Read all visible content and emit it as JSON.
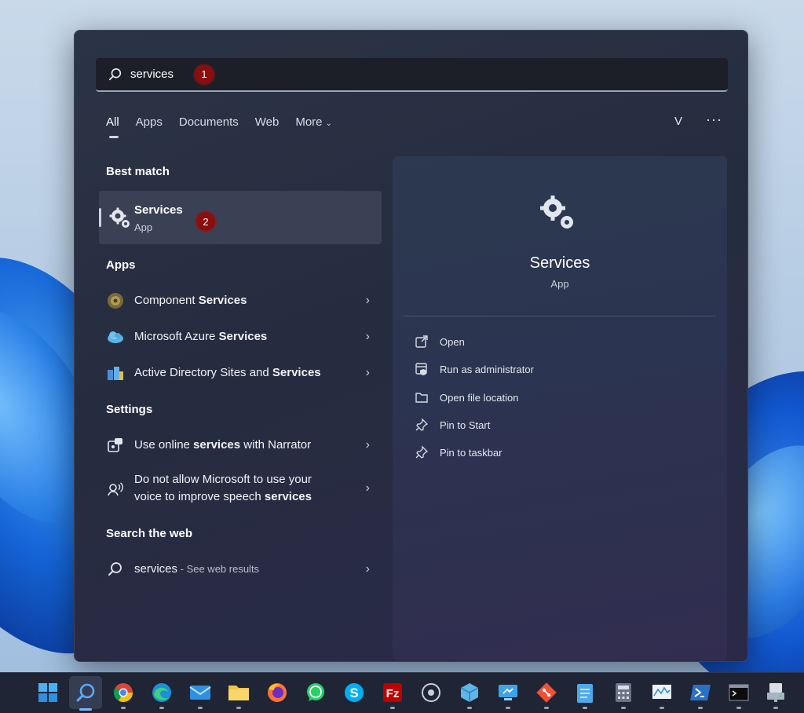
{
  "search": {
    "value": "services",
    "step_badge": "1"
  },
  "tabs": [
    {
      "label": "All"
    },
    {
      "label": "Apps"
    },
    {
      "label": "Documents"
    },
    {
      "label": "Web"
    },
    {
      "label": "More"
    }
  ],
  "header": {
    "avatar_letter": "V",
    "more_options": "···"
  },
  "sections": {
    "best_match": "Best match",
    "apps": "Apps",
    "settings": "Settings",
    "search_web": "Search the web"
  },
  "best_match": {
    "title": "Services",
    "subtitle": "App",
    "step_badge": "2"
  },
  "apps": [
    {
      "prefix": "Component ",
      "bold": "Services",
      "icon": "component-services-icon"
    },
    {
      "prefix": "Microsoft Azure ",
      "bold": "Services",
      "icon": "azure-cloud-icon"
    },
    {
      "prefix": "Active Directory Sites and ",
      "bold": "Services",
      "icon": "active-directory-icon"
    }
  ],
  "settings": [
    {
      "line1_a": "Use online ",
      "line1_b": "services",
      "line1_c": " with Narrator",
      "icon": "narrator-icon"
    },
    {
      "line1": "Do not allow Microsoft to use your",
      "line2_a": "voice to improve speech ",
      "line2_b": "services",
      "icon": "speech-icon"
    }
  ],
  "web": {
    "query": "services",
    "suffix": " - See web results"
  },
  "details": {
    "title": "Services",
    "subtitle": "App",
    "actions": [
      {
        "label": "Open",
        "icon": "open-external-icon"
      },
      {
        "label": "Run as administrator",
        "icon": "shield-admin-icon"
      },
      {
        "label": "Open file location",
        "icon": "folder-icon"
      },
      {
        "label": "Pin to Start",
        "icon": "pin-icon"
      },
      {
        "label": "Pin to taskbar",
        "icon": "pin-icon"
      }
    ]
  },
  "taskbar": {
    "apps": [
      "start",
      "search",
      "chrome",
      "edge",
      "mail",
      "file-explorer",
      "firefox",
      "whatsapp",
      "skype",
      "filezilla",
      "cortana",
      "packages",
      "remote-desktop",
      "git",
      "notepad",
      "calculator",
      "performance-monitor",
      "powershell",
      "terminal",
      "network-drive"
    ]
  },
  "colors": {
    "badge": "#8a0e0e",
    "panel": "#262c3f",
    "taskbar": "#1f2535",
    "accent": "#7fb4ff"
  }
}
